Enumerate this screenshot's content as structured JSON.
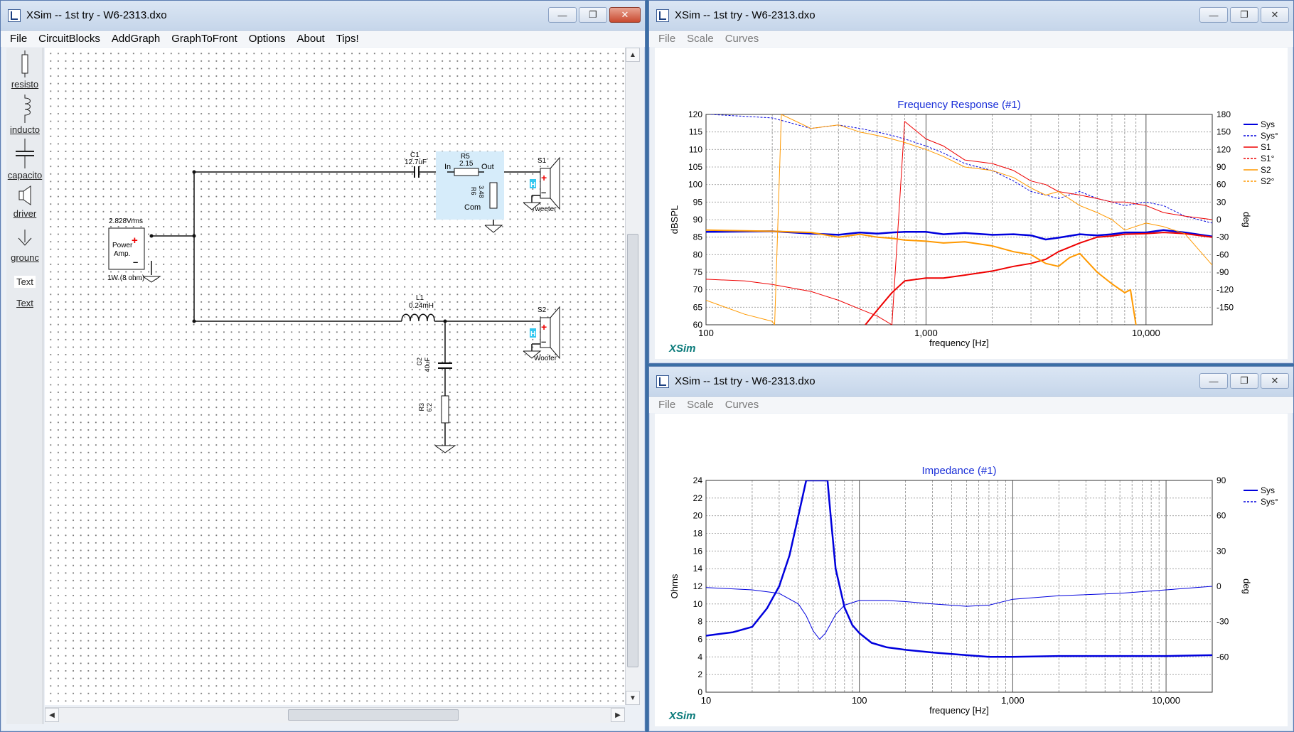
{
  "left_window": {
    "title": "XSim -- 1st try - W6-2313.dxo",
    "menu": [
      "File",
      "CircuitBlocks",
      "AddGraph",
      "GraphToFront",
      "Options",
      "About",
      "Tips!"
    ],
    "toolbox": [
      "resisto",
      "inducto",
      "capacito",
      "driver",
      "grounc",
      "Text",
      "Text"
    ],
    "schematic": {
      "amp_top": "2.828Vrms",
      "amp_label1": "Power",
      "amp_label2": "Amp.",
      "amp_bottom": "1W (8 ohm)",
      "c1_name": "C1",
      "c1_value": "12.7uF",
      "r5_name": "R5",
      "r5_value": "2.15",
      "in_label": "In",
      "out_label": "Out",
      "com_label": "Com",
      "r6_name": "R6",
      "r6_value": "3.48",
      "s1_name": "S1",
      "s1_label": "Tweeter",
      "l1_name": "L1",
      "l1_value": "0.24mH",
      "s2_name": "S2",
      "s2_label": "Woofer",
      "c2_name": "C2",
      "c2_value": "40uF",
      "r3_name": "R3",
      "r3_value": "6.2"
    }
  },
  "freq_window": {
    "title": "XSim -- 1st try - W6-2313.dxo",
    "menu": [
      "File",
      "Scale",
      "Curves"
    ],
    "logo": "XSim"
  },
  "imp_window": {
    "title": "XSim -- 1st try - W6-2313.dxo",
    "menu": [
      "File",
      "Scale",
      "Curves"
    ],
    "logo": "XSim"
  },
  "chart_data": [
    {
      "type": "line",
      "title": "Frequency Response (#1)",
      "xlabel": "frequency [Hz]",
      "ylabel": "dBSPL",
      "y2label": "deg",
      "xscale": "log",
      "xlim": [
        100,
        20000
      ],
      "ylim": [
        60,
        120
      ],
      "y2lim": [
        -180,
        180
      ],
      "x_ticks": [
        "100",
        "1,000",
        "10,000"
      ],
      "y_ticks": [
        60,
        65,
        70,
        75,
        80,
        85,
        90,
        95,
        100,
        105,
        110,
        115,
        120
      ],
      "y2_ticks": [
        -150,
        -120,
        -90,
        -60,
        -30,
        0,
        30,
        60,
        90,
        120,
        150,
        180
      ],
      "legend": "top-right",
      "grid": true,
      "series": [
        {
          "name": "Sys",
          "color": "#0000dd",
          "style": "solid",
          "width": 2.5,
          "axis": "y2",
          "x": [
            100,
            200,
            300,
            400,
            500,
            600,
            700,
            800,
            1000,
            1200,
            1500,
            2000,
            2500,
            3000,
            3500,
            4000,
            5000,
            6000,
            7000,
            8000,
            10000,
            12000,
            15000,
            20000
          ],
          "y": [
            -21,
            -20,
            -24,
            -26,
            -22,
            -24,
            -22,
            -21,
            -21,
            -25,
            -23,
            -26,
            -25,
            -27,
            -34,
            -31,
            -25,
            -27,
            -25,
            -22,
            -22,
            -18,
            -22,
            -29
          ]
        },
        {
          "name": "Sys°",
          "color": "#0000dd",
          "style": "dotted",
          "width": 1,
          "axis": "y",
          "x": [
            105,
            200,
            300,
            400,
            500,
            600,
            700,
            800,
            1000,
            1200,
            1500,
            2000,
            2500,
            3000,
            3500,
            4000,
            5000,
            6000,
            7000,
            8000,
            10000,
            12000,
            15000,
            20000
          ],
          "y": [
            120,
            119,
            116,
            117,
            116,
            115,
            114,
            113,
            111,
            109,
            106,
            104,
            101,
            98,
            97,
            96,
            98,
            96,
            95,
            94,
            95,
            94,
            91,
            89
          ]
        },
        {
          "name": "S1",
          "color": "#ee0000",
          "style": "solid",
          "width": 2,
          "axis": "y2",
          "x": [
            530,
            600,
            700,
            800,
            1000,
            1200,
            1500,
            2000,
            2500,
            3000,
            3500,
            4000,
            5000,
            6000,
            7000,
            8000,
            10000,
            12000,
            15000,
            20000
          ],
          "y": [
            -180,
            -155,
            -125,
            -105,
            -100,
            -100,
            -95,
            -88,
            -80,
            -75,
            -68,
            -55,
            -40,
            -30,
            -28,
            -25,
            -24,
            -22,
            -24,
            -30
          ]
        },
        {
          "name": "S1°",
          "color": "#ee0000",
          "style": "solid",
          "width": 1,
          "axis": "y",
          "x": [
            100,
            150,
            200,
            300,
            400,
            500,
            600,
            700,
            800,
            1000,
            1200,
            1500,
            2000,
            2500,
            3000,
            3500,
            4000,
            5000,
            6000,
            7000,
            8000,
            10000,
            12000,
            15000,
            20000
          ],
          "y": [
            73,
            72.5,
            71.5,
            69.5,
            67,
            64.5,
            62.5,
            60,
            118,
            113,
            111,
            107,
            106,
            104,
            101,
            100,
            98,
            97,
            96,
            95,
            95,
            94,
            92,
            91,
            90
          ]
        },
        {
          "name": "S2",
          "color": "#ff9900",
          "style": "solid",
          "width": 2,
          "axis": "y2",
          "x": [
            100,
            200,
            300,
            400,
            500,
            600,
            700,
            800,
            1000,
            1200,
            1500,
            2000,
            2500,
            3000,
            3500,
            4000,
            4500,
            5000,
            6000,
            7000,
            8000,
            8500,
            9000
          ],
          "y": [
            -18,
            -20,
            -22,
            -30,
            -25,
            -30,
            -32,
            -35,
            -37,
            -40,
            -38,
            -45,
            -55,
            -60,
            -75,
            -80,
            -65,
            -58,
            -90,
            -110,
            -125,
            -120,
            -180
          ]
        },
        {
          "name": "S2°",
          "color": "#ff9900",
          "style": "solid",
          "width": 1,
          "axis": "y",
          "x": [
            100,
            150,
            200,
            205,
            220,
            300,
            400,
            500,
            600,
            700,
            800,
            1000,
            1200,
            1500,
            2000,
            2500,
            3000,
            3500,
            4000,
            5000,
            6000,
            7000,
            8000,
            10000,
            12000,
            15000,
            20000
          ],
          "y": [
            67,
            63,
            61,
            60,
            120,
            116,
            117,
            115,
            114,
            113,
            112,
            110,
            108,
            105,
            104,
            102,
            99,
            97,
            98,
            94,
            92,
            90,
            87,
            89,
            88,
            86,
            77
          ]
        }
      ]
    },
    {
      "type": "line",
      "title": "Impedance (#1)",
      "xlabel": "frequency [Hz]",
      "ylabel": "Ohms",
      "y2label": "deg",
      "xscale": "log",
      "xlim": [
        10,
        20000
      ],
      "ylim": [
        0,
        24
      ],
      "y2lim": [
        -90,
        90
      ],
      "x_ticks": [
        "10",
        "100",
        "1,000",
        "10,000"
      ],
      "y_ticks": [
        0,
        2,
        4,
        6,
        8,
        10,
        12,
        14,
        16,
        18,
        20,
        22,
        24
      ],
      "y2_ticks": [
        -60,
        -30,
        0,
        30,
        60,
        90
      ],
      "legend": "top-right",
      "grid": true,
      "series": [
        {
          "name": "Sys",
          "color": "#0000dd",
          "style": "solid",
          "width": 2.5,
          "axis": "y",
          "x": [
            10,
            15,
            20,
            25,
            30,
            35,
            40,
            45,
            48,
            62,
            65,
            70,
            80,
            90,
            100,
            120,
            150,
            200,
            300,
            500,
            700,
            1000,
            2000,
            5000,
            10000,
            20000
          ],
          "y": [
            6.4,
            6.8,
            7.4,
            9.5,
            12,
            15.5,
            20,
            24,
            24,
            24,
            20,
            14,
            9.6,
            7.6,
            6.7,
            5.6,
            5.1,
            4.8,
            4.5,
            4.2,
            4.0,
            4.0,
            4.1,
            4.1,
            4.1,
            4.2
          ]
        },
        {
          "name": "Sys°",
          "color": "#0000dd",
          "style": "solid",
          "width": 1,
          "axis": "y2",
          "x": [
            10,
            20,
            30,
            40,
            45,
            50,
            55,
            60,
            70,
            80,
            100,
            150,
            200,
            300,
            500,
            700,
            1000,
            2000,
            5000,
            10000,
            20000
          ],
          "y": [
            -1,
            -3,
            -6,
            -15,
            -25,
            -38,
            -45,
            -40,
            -24,
            -16,
            -12,
            -12,
            -13,
            -15,
            -17,
            -16,
            -11,
            -8,
            -6,
            -3,
            0
          ]
        }
      ]
    }
  ]
}
